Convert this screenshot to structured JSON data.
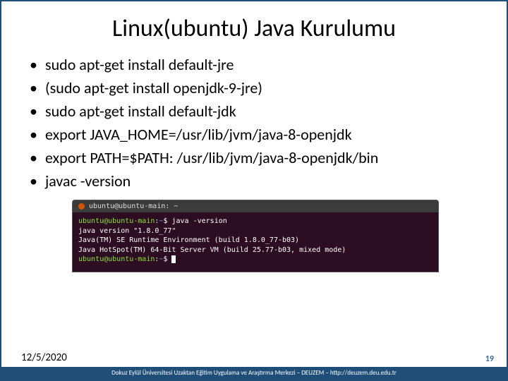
{
  "title": "Linux(ubuntu) Java Kurulumu",
  "bullets": [
    "sudo apt-get install default-jre",
    "(sudo apt-get install openjdk-9-jre)",
    "sudo apt-get install default-jdk",
    "export JAVA_HOME=/usr/lib/jvm/java-8-openjdk",
    "export PATH=$PATH: /usr/lib/jvm/java-8-openjdk/bin",
    "javac -version"
  ],
  "terminal": {
    "window_title": "ubuntu@ubuntu-main: ~",
    "prompt_user": "ubuntu@ubuntu-main",
    "prompt_path": "~",
    "command": "java -version",
    "output": [
      "java version \"1.8.0_77\"",
      "Java(TM) SE Runtime Environment (build 1.8.0_77-b03)",
      "Java HotSpot(TM) 64-Bit Server VM (build 25.77-b03, mixed mode)"
    ]
  },
  "footer": {
    "date": "12/5/2020",
    "page": "19",
    "org": "Dokuz Eylül Üniversitesi Uzaktan Eğitim Uygulama ve Araştırma Merkezi – DEUZEM – http://deuzem.deu.edu.tr"
  }
}
